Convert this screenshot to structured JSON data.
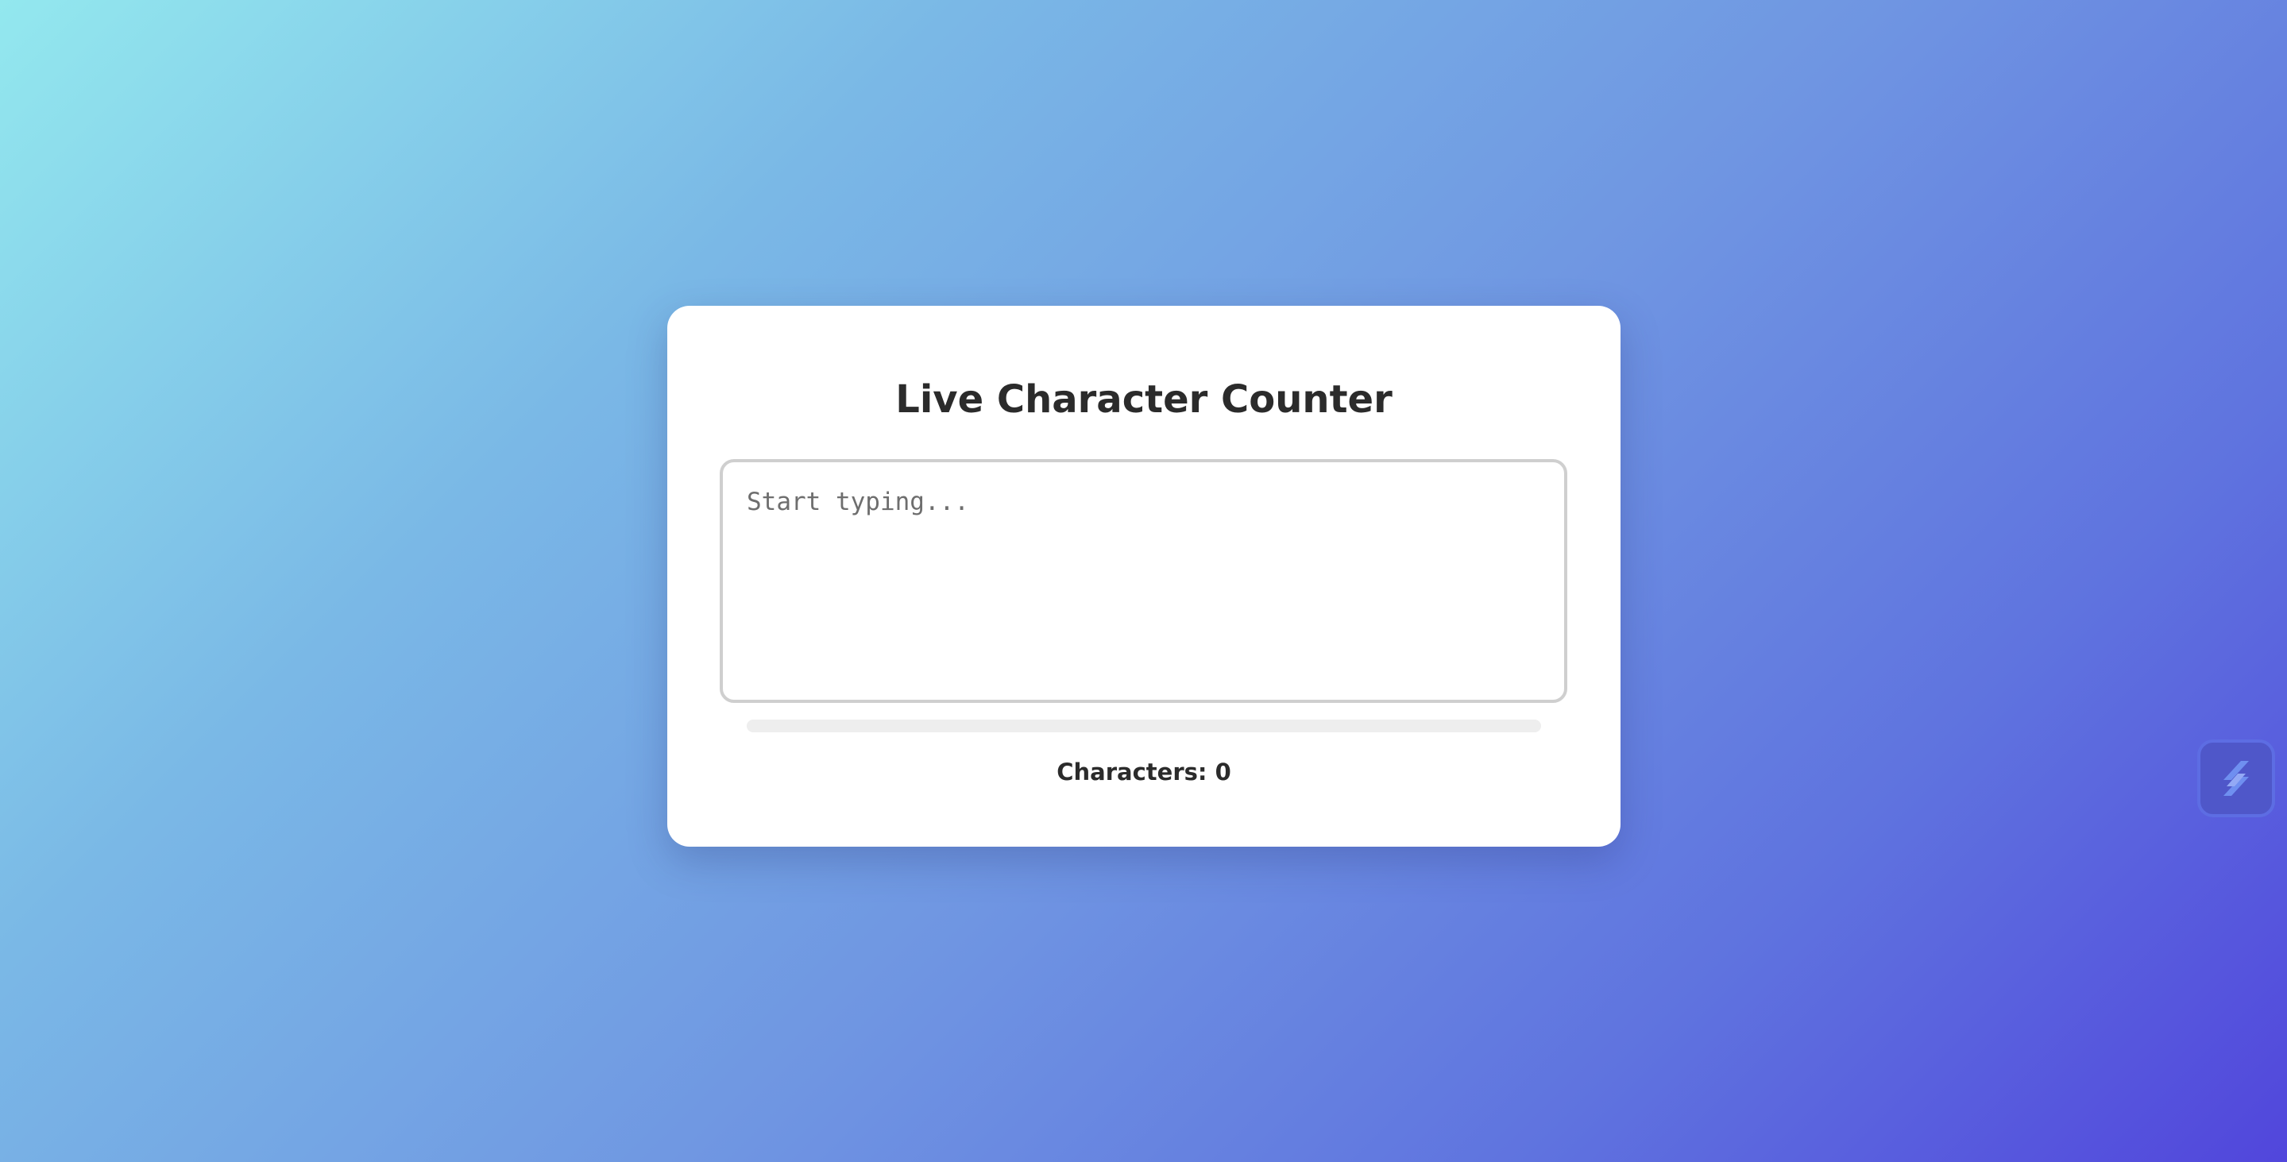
{
  "app": {
    "title": "Live Character Counter"
  },
  "editor": {
    "placeholder": "Start typing...",
    "value": ""
  },
  "progress": {
    "fraction": 0
  },
  "counter": {
    "label": "Characters: 0"
  },
  "side_widget": {
    "icon": "extension-logo-icon"
  },
  "colors": {
    "gradient_start": "#93e8ee",
    "gradient_end": "#5146dc",
    "card_background": "#ffffff",
    "text": "#2b2b2b"
  }
}
